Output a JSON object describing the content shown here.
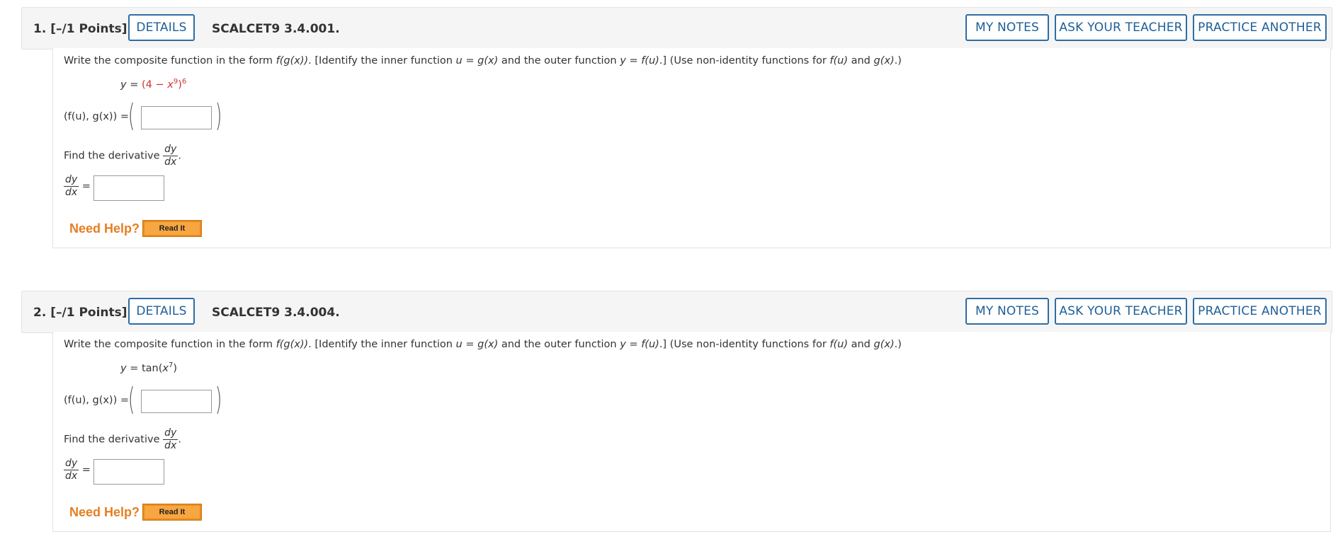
{
  "questions": [
    {
      "number": "1.",
      "points": "[–/1 Points]",
      "details_label": "DETAILS",
      "code": "SCALCET9 3.4.001.",
      "my_notes_label": "MY NOTES",
      "ask_teacher_label": "ASK YOUR TEACHER",
      "practice_label": "PRACTICE ANOTHER",
      "prompt_a": "Write the composite function in the form ",
      "prompt_fgx": "f(g(x))",
      "prompt_b": ". [Identify the inner function ",
      "prompt_u": "u",
      "prompt_c": " = ",
      "prompt_gx": "g(x)",
      "prompt_d": " and the outer function ",
      "prompt_y": "y",
      "prompt_e": " = ",
      "prompt_fu": "f(u)",
      "prompt_f": ".] (Use non-identity functions for ",
      "prompt_fu2": "f(u)",
      "prompt_g": " and ",
      "prompt_gx2": "g(x)",
      "prompt_h": ".)",
      "equation_lhs": "y",
      "equation_eq": " = ",
      "equation_parts": [
        "(",
        "4",
        " − ",
        "x",
        "9",
        ")",
        "6"
      ],
      "pair_label": "(f(u), g(x)) =",
      "find_text": "Find the derivative",
      "frac_num": "dy",
      "frac_den": "dx",
      "answer1_value": "",
      "answer2_value": "",
      "need_help": "Need Help?",
      "read_it": "Read It"
    },
    {
      "number": "2.",
      "points": "[–/1 Points]",
      "details_label": "DETAILS",
      "code": "SCALCET9 3.4.004.",
      "my_notes_label": "MY NOTES",
      "ask_teacher_label": "ASK YOUR TEACHER",
      "practice_label": "PRACTICE ANOTHER",
      "prompt_a": "Write the composite function in the form ",
      "prompt_fgx": "f(g(x))",
      "prompt_b": ". [Identify the inner function ",
      "prompt_u": "u",
      "prompt_c": " = ",
      "prompt_gx": "g(x)",
      "prompt_d": " and the outer function ",
      "prompt_y": "y",
      "prompt_e": " = ",
      "prompt_fu": "f(u)",
      "prompt_f": ".] (Use non-identity functions for ",
      "prompt_fu2": "f(u)",
      "prompt_g": " and ",
      "prompt_gx2": "g(x)",
      "prompt_h": ".)",
      "equation_lhs": "y",
      "equation_eq": " = ",
      "equation_parts": [
        "tan(",
        "x",
        "7",
        ")"
      ],
      "pair_label": "(f(u), g(x)) =",
      "find_text": "Find the derivative",
      "frac_num": "dy",
      "frac_den": "dx",
      "answer1_value": "",
      "answer2_value": "",
      "need_help": "Need Help?",
      "read_it": "Read It"
    }
  ],
  "colors": {
    "button_border": "#2e6da4",
    "button_text": "#1e5f96",
    "help_orange": "#e67e22",
    "readit_bg": "#f7a642",
    "math_red": "#d0322f"
  }
}
